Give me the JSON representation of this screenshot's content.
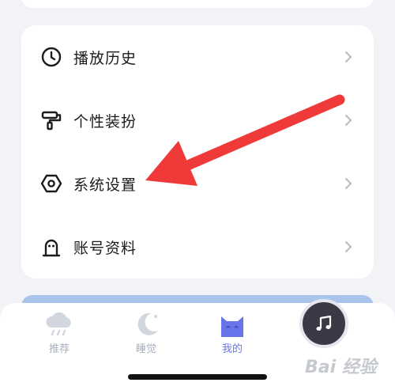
{
  "menu": {
    "items": [
      {
        "label": "播放历史",
        "icon": "clock-icon"
      },
      {
        "label": "个性装扮",
        "icon": "paint-roller-icon"
      },
      {
        "label": "系统设置",
        "icon": "hexagon-settings-icon"
      },
      {
        "label": "账号资料",
        "icon": "user-icon"
      }
    ]
  },
  "tabbar": {
    "tabs": [
      {
        "label": "推荐",
        "icon": "rain-cloud-icon"
      },
      {
        "label": "睡觉",
        "icon": "moon-icon"
      },
      {
        "label": "我的",
        "icon": "cat-face-icon",
        "active": true
      }
    ],
    "music_icon": "music-note-icon"
  },
  "watermark": {
    "text": "Bai 经验"
  },
  "colors": {
    "accent": "#6875ea",
    "arrow": "#f03a3a",
    "background": "#f2f3f7"
  }
}
